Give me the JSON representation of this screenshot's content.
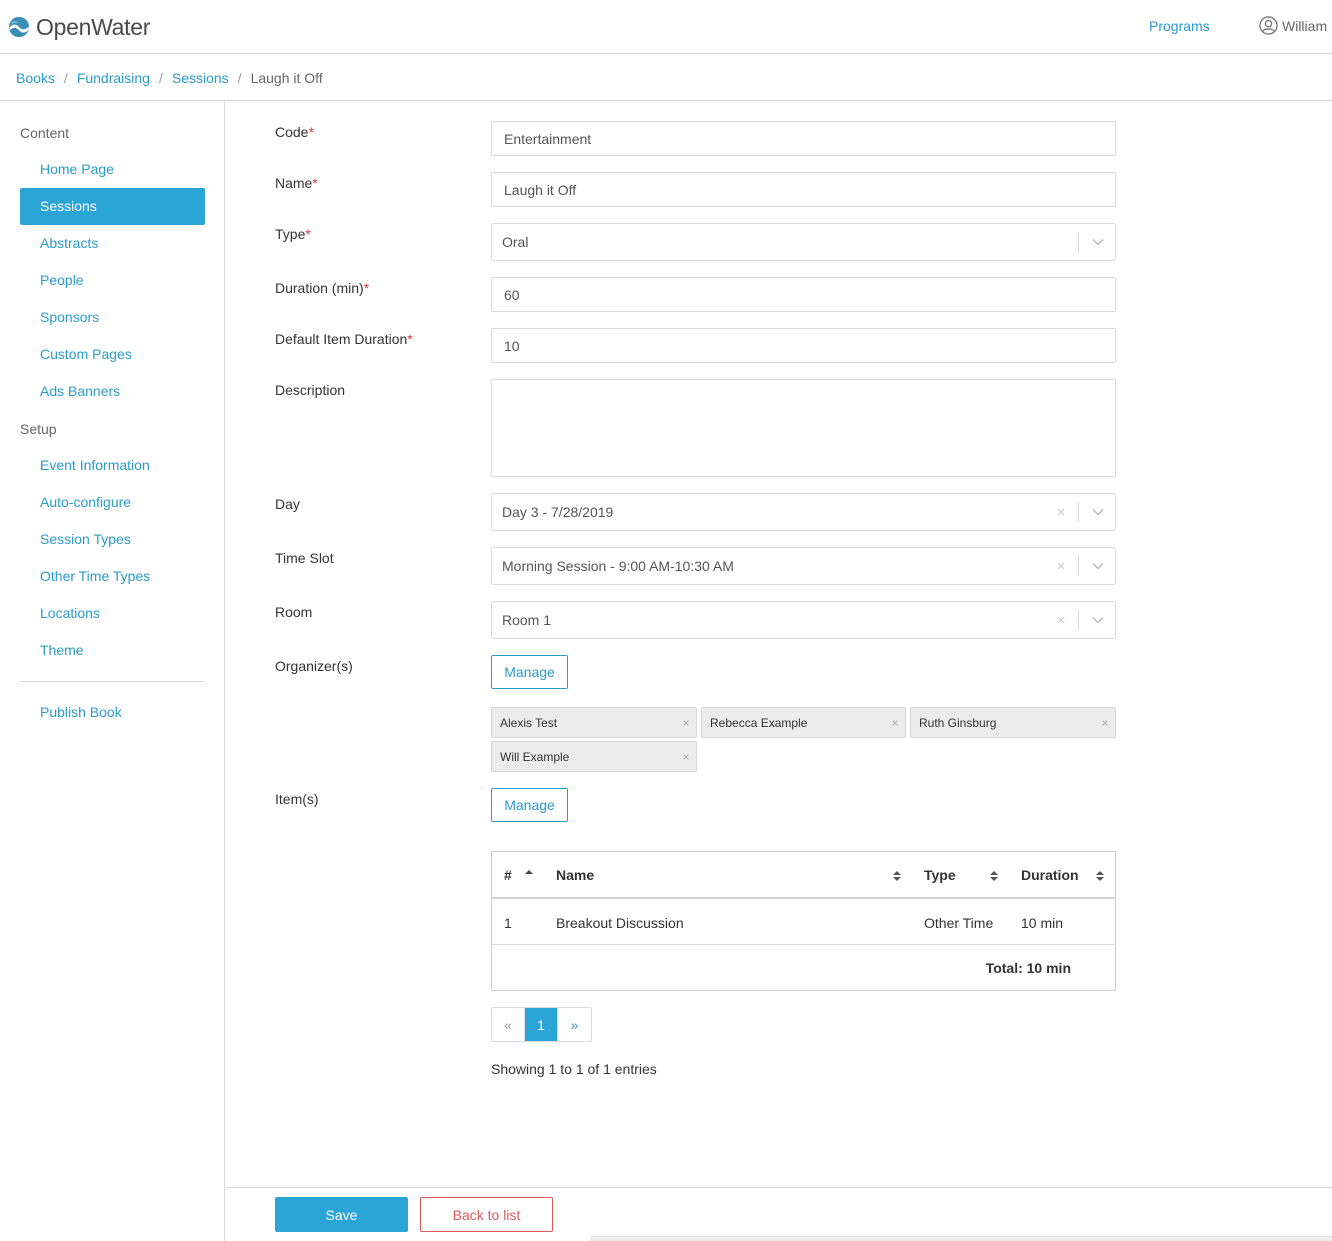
{
  "header": {
    "logo_text": "OpenWater",
    "nav_programs": "Programs",
    "user_name": "William"
  },
  "breadcrumb": {
    "items": [
      "Books",
      "Fundraising",
      "Sessions"
    ],
    "current": "Laugh it Off"
  },
  "sidebar": {
    "content_heading": "Content",
    "content_items": [
      "Home Page",
      "Sessions",
      "Abstracts",
      "People",
      "Sponsors",
      "Custom Pages",
      "Ads Banners"
    ],
    "setup_heading": "Setup",
    "setup_items": [
      "Event Information",
      "Auto-configure",
      "Session Types",
      "Other Time Types",
      "Locations",
      "Theme"
    ],
    "publish": "Publish Book",
    "active": "Sessions"
  },
  "form": {
    "code": {
      "label": "Code",
      "value": "Entertainment"
    },
    "name": {
      "label": "Name",
      "value": "Laugh it Off"
    },
    "type": {
      "label": "Type",
      "value": "Oral"
    },
    "duration": {
      "label": "Duration (min)",
      "value": "60"
    },
    "default_item_duration": {
      "label": "Default Item Duration",
      "value": "10"
    },
    "description": {
      "label": "Description",
      "value": ""
    },
    "day": {
      "label": "Day",
      "value": "Day 3 - 7/28/2019"
    },
    "time_slot": {
      "label": "Time Slot",
      "value": "Morning Session - 9:00 AM-10:30 AM"
    },
    "room": {
      "label": "Room",
      "value": "Room 1"
    },
    "organizers": {
      "label": "Organizer(s)",
      "manage": "Manage",
      "tags": [
        "Alexis Test",
        "Rebecca Example",
        "Ruth Ginsburg",
        "Will Example"
      ]
    },
    "items": {
      "label": "Item(s)",
      "manage": "Manage"
    },
    "required_mark": "*",
    "clear_glyph": "×"
  },
  "table": {
    "columns": [
      "#",
      "Name",
      "Type",
      "Duration"
    ],
    "rows": [
      {
        "num": "1",
        "name": "Breakout Discussion",
        "type": "Other Time",
        "duration": "10 min"
      }
    ],
    "total": "Total: 10 min"
  },
  "pagination": {
    "prev": "«",
    "current": "1",
    "next": "»",
    "showing": "Showing 1 to 1 of 1 entries"
  },
  "footer": {
    "save": "Save",
    "back": "Back to list"
  },
  "colors": {
    "accent": "#2ba5d6",
    "link": "#2b9bc9",
    "danger": "#e05a5a",
    "required": "#d9363e"
  }
}
